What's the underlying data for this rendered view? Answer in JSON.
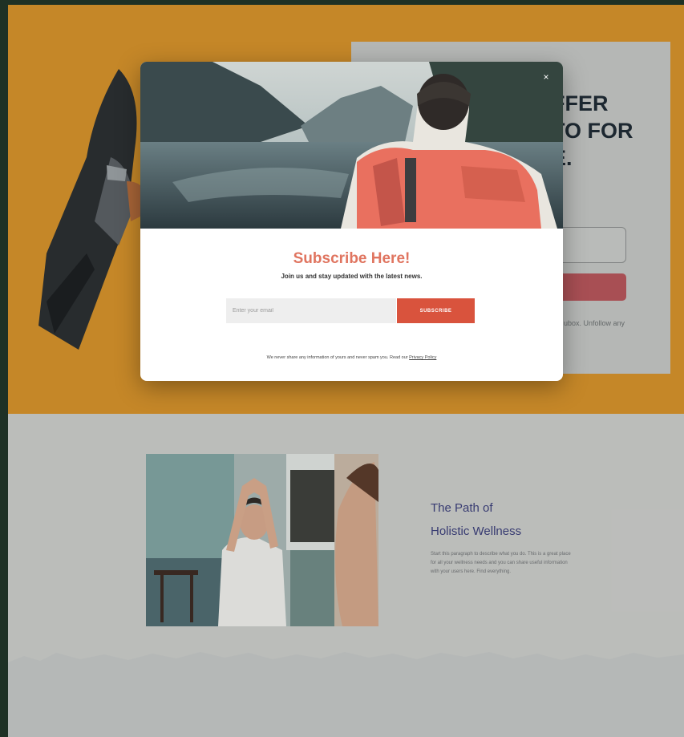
{
  "hero": {
    "heading": "FFER\nTO FOR\nE.",
    "note": "ubox. Unfollow any"
  },
  "wellness": {
    "title_line1": "The Path of",
    "title_line2": "Holistic Wellness",
    "body": "Start this paragraph to describe what you do. This is a great place for all your wellness needs and you can share useful information with your users here. Find everything."
  },
  "modal": {
    "close_symbol": "×",
    "title": "Subscribe Here!",
    "subtitle": "Join us and stay updated with the latest news.",
    "email_placeholder": "Enter your email",
    "submit_label": "SUBSCRIBE",
    "privacy_text": "We never share any information of yours and never spam you. Read our ",
    "privacy_link": "Privacy Policy"
  },
  "colors": {
    "hero_bg": "#d4912a",
    "accent": "#d9533d",
    "title_accent": "#e07560",
    "wellness_title": "#3b3f7a"
  }
}
